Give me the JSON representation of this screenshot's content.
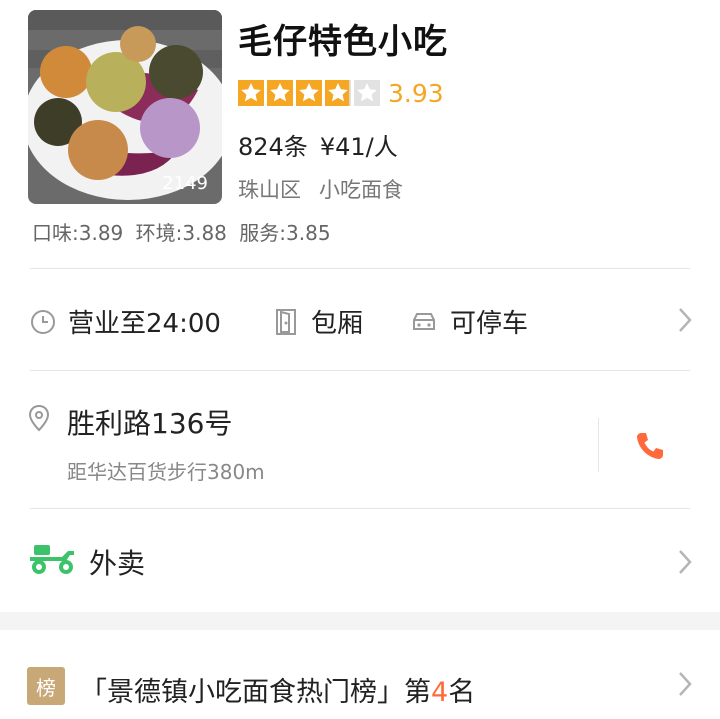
{
  "shop": {
    "name": "毛仔特色小吃",
    "photo_count": "2149",
    "rating": 3.93,
    "rating_text": "3.93",
    "stars_total": 5,
    "reviews": "824条",
    "price": "¥41/人",
    "district": "珠山区",
    "category": "小吃面食",
    "score_taste": "口味:3.89",
    "score_env": "环境:3.88",
    "score_service": "服务:3.85"
  },
  "facilities": {
    "hours": "营业至24:00",
    "private_room": "包厢",
    "parking": "可停车"
  },
  "address": {
    "street": "胜利路136号",
    "distance": "距华达百货步行380m"
  },
  "takeout": {
    "label": "外卖"
  },
  "ranking": {
    "badge": "榜",
    "prefix": "「景德镇小吃面食热门榜」第",
    "rank": "4",
    "suffix": "名"
  },
  "colors": {
    "star": "#f5a623",
    "phone": "#ff6a3c",
    "takeout": "#3cc36a",
    "rank_number": "#ff6a3c",
    "rank_badge": "#c9a877"
  },
  "icons": {
    "hours": "clock-icon",
    "room": "door-icon",
    "parking": "car-icon",
    "location": "location-pin-icon",
    "phone": "phone-icon",
    "takeout": "scooter-icon",
    "chevron": "chevron-right-icon"
  }
}
